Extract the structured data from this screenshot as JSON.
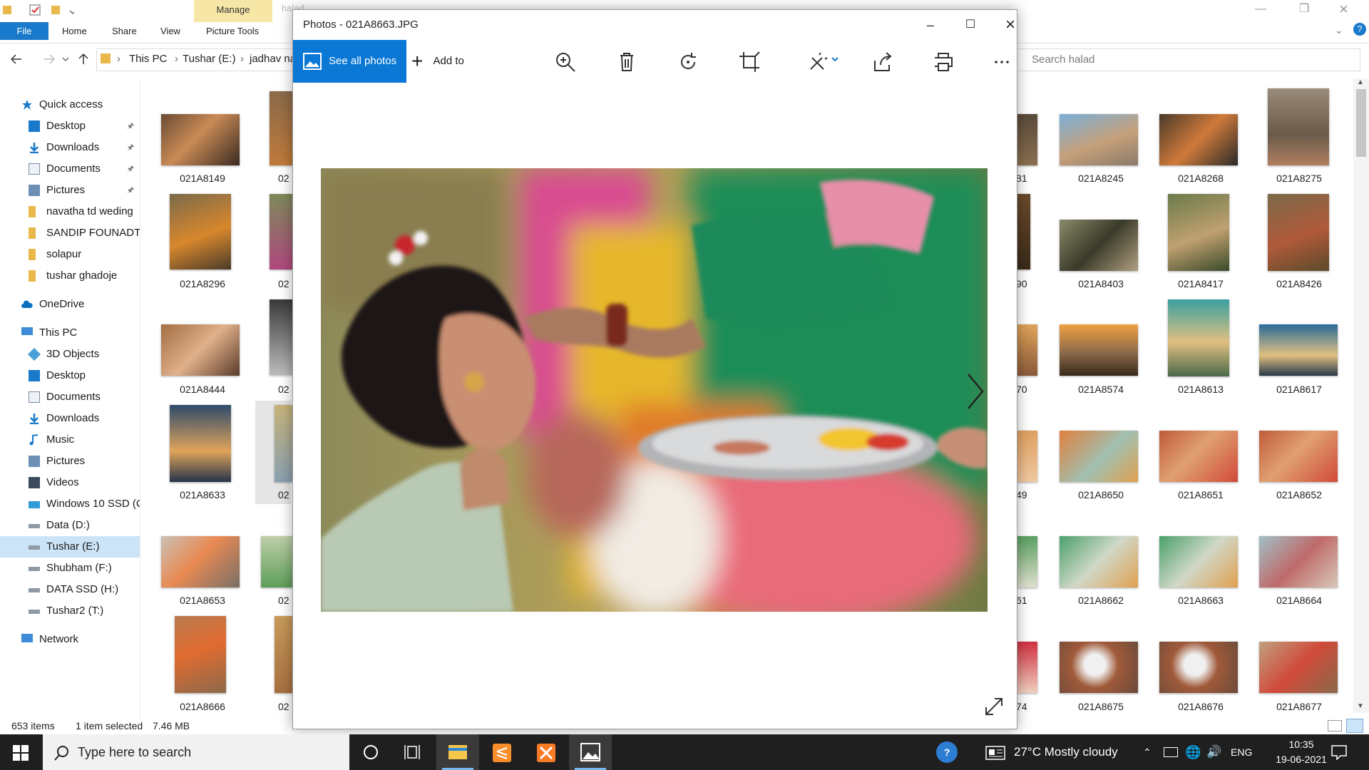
{
  "explorer": {
    "ribbon": {
      "manage_tab": "Manage",
      "ghost_title": "halad",
      "tabs": [
        "File",
        "Home",
        "Share",
        "View",
        "Picture Tools"
      ]
    },
    "address": {
      "crumbs": [
        "This PC",
        "Tushar (E:)",
        "jadhav na"
      ],
      "search_placeholder": "Search halad"
    },
    "nav": {
      "quick_access": "Quick access",
      "quick_items": [
        "Desktop",
        "Downloads",
        "Documents",
        "Pictures",
        "navatha td weding",
        "SANDIP FOUNADTI(",
        "solapur",
        "tushar ghadoje"
      ],
      "onedrive": "OneDrive",
      "this_pc": "This PC",
      "pc_items": [
        "3D Objects",
        "Desktop",
        "Documents",
        "Downloads",
        "Music",
        "Pictures",
        "Videos",
        "Windows 10 SSD (C",
        "Data (D:)",
        "Tushar (E:)",
        "Shubham (F:)",
        "DATA SSD (H:)",
        "Tushar2 (T:)"
      ],
      "network": "Network"
    },
    "left_col": [
      "021A8149",
      "021A8296",
      "021A8444",
      "021A8633",
      "021A8653",
      "021A8666"
    ],
    "partial_col": [
      "02",
      "02",
      "02",
      "02",
      "02",
      "02"
    ],
    "right_partial": [
      "81",
      "90",
      "70",
      "49",
      "61",
      "74"
    ],
    "right_cols": [
      [
        "021A8245",
        "021A8268",
        "021A8275"
      ],
      [
        "021A8403",
        "021A8417",
        "021A8426"
      ],
      [
        "021A8574",
        "021A8613",
        "021A8617"
      ],
      [
        "021A8650",
        "021A8651",
        "021A8652"
      ],
      [
        "021A8662",
        "021A8663",
        "021A8664"
      ],
      [
        "021A8675",
        "021A8676",
        "021A8677"
      ]
    ],
    "status": {
      "count": "653 items",
      "selected": "1 item selected",
      "size": "7.46 MB"
    }
  },
  "photos": {
    "title": "Photos - 021A8663.JPG",
    "see_all": "See all photos",
    "add_to": "Add to"
  },
  "taskbar": {
    "search_placeholder": "Type here to search",
    "weather": "27°C  Mostly cloudy",
    "lang": "ENG",
    "time": "10:35",
    "date": "19-06-2021"
  }
}
